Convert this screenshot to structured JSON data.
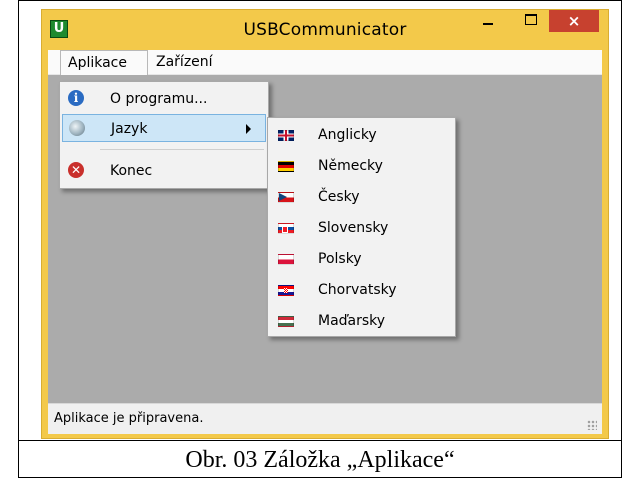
{
  "window": {
    "title": "USBCommunicator",
    "app_icon_letter": "U",
    "close_symbol": "×"
  },
  "menubar": {
    "items": [
      {
        "label": "Aplikace"
      },
      {
        "label": "Zařízení"
      }
    ]
  },
  "aplikace_menu": {
    "items": [
      {
        "label": "O programu...",
        "icon": "info-icon"
      },
      {
        "label": "Jazyk",
        "icon": "globe-icon",
        "has_submenu": true
      },
      {
        "label": "Konec",
        "icon": "exit-icon"
      }
    ]
  },
  "jazyk_menu": {
    "items": [
      {
        "label": "Anglicky",
        "icon": "flag-uk-icon"
      },
      {
        "label": "Německy",
        "icon": "flag-de-icon"
      },
      {
        "label": "Česky",
        "icon": "flag-cz-icon"
      },
      {
        "label": "Slovensky",
        "icon": "flag-sk-icon"
      },
      {
        "label": "Polsky",
        "icon": "flag-pl-icon"
      },
      {
        "label": "Chorvatsky",
        "icon": "flag-hr-icon"
      },
      {
        "label": "Maďarsky",
        "icon": "flag-hu-icon"
      }
    ]
  },
  "statusbar": {
    "text": "Aplikace je připravena."
  },
  "caption": "Obr. 03 Záložka „Aplikace“",
  "colors": {
    "frame": "#f3c94a",
    "close_button": "#c7412f",
    "client_area": "#ababab",
    "menu_highlight": "#cde6f7"
  }
}
